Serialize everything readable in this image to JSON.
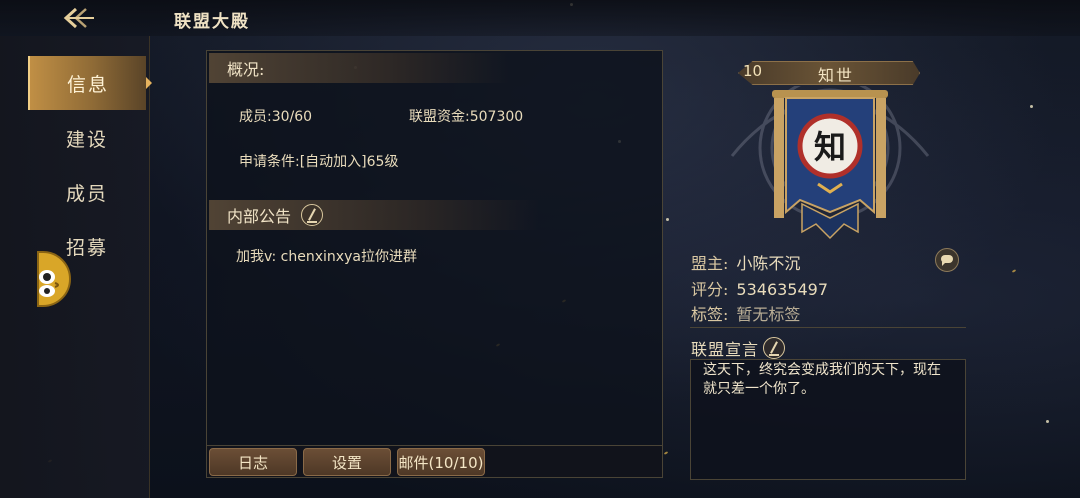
{
  "header": {
    "title": "联盟大殿"
  },
  "sidebar": {
    "tabs": [
      {
        "label": "信息",
        "active": true
      },
      {
        "label": "建设",
        "active": false
      },
      {
        "label": "成员",
        "active": false
      },
      {
        "label": "招募",
        "active": false
      }
    ]
  },
  "overview": {
    "heading": "概况:",
    "members": "成员:30/60",
    "funds": "联盟资金:507300",
    "requirement": "申请条件:[自动加入]65级"
  },
  "notice": {
    "heading": "内部公告",
    "content": "加我v: chenxinxya拉你进群"
  },
  "bottom_buttons": {
    "log": "日志",
    "settings": "设置",
    "mail": "邮件(10/10)"
  },
  "alliance": {
    "level": "10",
    "name": "知世",
    "emblem_char": "知",
    "leader_label": "盟主:",
    "leader": "小陈不沉",
    "score_label": "评分:",
    "score": "534635497",
    "tag_label": "标签:",
    "tag": "暂无标签",
    "declaration_title": "联盟宣言",
    "declaration": "这天下，终究会变成我们的天下，现在就只差一个你了。"
  },
  "colors": {
    "accent_gold": "#c08f45",
    "banner_blue": "#24407a",
    "emblem_red": "#b0302a"
  }
}
